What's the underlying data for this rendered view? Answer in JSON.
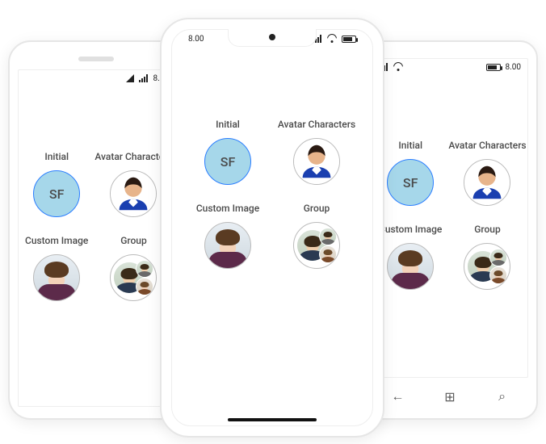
{
  "status_time": "8.00",
  "labels": {
    "initial": "Initial",
    "characters": "Avatar Characters",
    "custom_image": "Custom Image",
    "group": "Group"
  },
  "initials_text": "SF",
  "icons": {
    "win_back": "←",
    "win_home": "⊞",
    "win_search": "⌕"
  }
}
